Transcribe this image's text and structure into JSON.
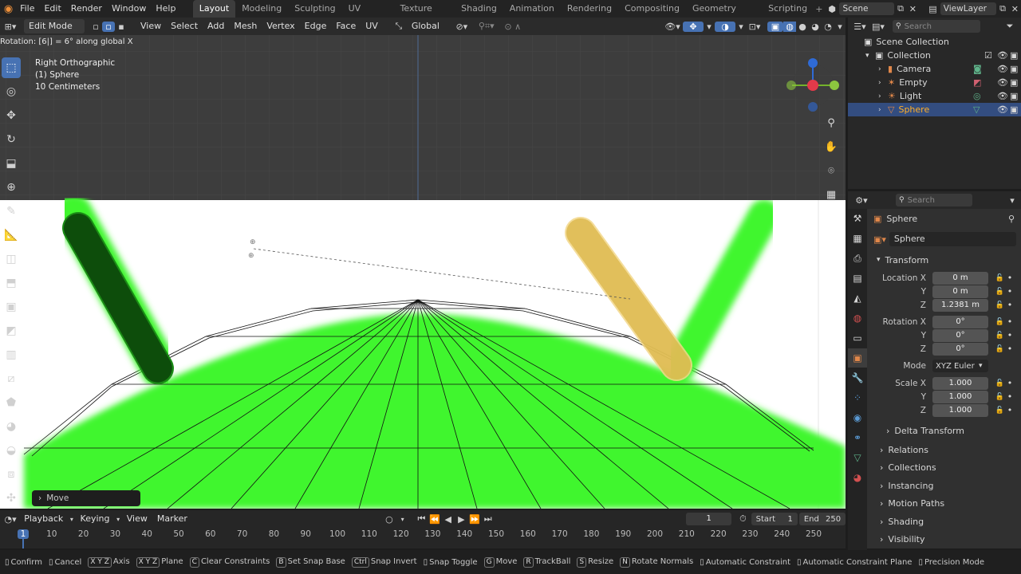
{
  "menu": {
    "items": [
      "File",
      "Edit",
      "Render",
      "Window",
      "Help"
    ]
  },
  "workspaces": {
    "tabs": [
      "Layout",
      "Modeling",
      "Sculpting",
      "UV Editing",
      "Texture Paint",
      "Shading",
      "Animation",
      "Rendering",
      "Compositing",
      "Geometry Nodes",
      "Scripting"
    ],
    "active": "Layout"
  },
  "scene": {
    "name": "Scene",
    "view_layer": "ViewLayer"
  },
  "viewport_header": {
    "mode": "Edit Mode",
    "menus": [
      "View",
      "Select",
      "Add",
      "Mesh",
      "Vertex",
      "Edge",
      "Face",
      "UV"
    ],
    "transform_orientation": "Global"
  },
  "status_text": "Rotation: [6|] = 6°  along global X",
  "overlay": {
    "view": "Right Orthographic",
    "object": "(1) Sphere",
    "scale": "10 Centimeters"
  },
  "operator_panel": {
    "label": "Move"
  },
  "outliner": {
    "search_placeholder": "Search",
    "root": "Scene Collection",
    "collection": "Collection",
    "items": [
      {
        "name": "Camera",
        "icon": "camera-icon",
        "color": "#e0874a"
      },
      {
        "name": "Empty",
        "icon": "empty-icon",
        "color": "#e0874a"
      },
      {
        "name": "Light",
        "icon": "light-icon",
        "color": "#e0874a"
      },
      {
        "name": "Sphere",
        "icon": "mesh-icon",
        "color": "#e0874a",
        "selected": true
      }
    ]
  },
  "properties": {
    "search_placeholder": "Search",
    "object_name": "Sphere",
    "data_name": "Sphere",
    "transform": {
      "title": "Transform",
      "location_label": "Location X",
      "location": [
        "0 m",
        "0 m",
        "1.2381 m"
      ],
      "rotation_label": "Rotation X",
      "rotation": [
        "0°",
        "0°",
        "0°"
      ],
      "mode_label": "Mode",
      "mode": "XYZ Euler",
      "scale_label": "Scale X",
      "scale": [
        "1.000",
        "1.000",
        "1.000"
      ],
      "y_label": "Y",
      "z_label": "Z"
    },
    "delta": "Delta Transform",
    "panels": [
      "Relations",
      "Collections",
      "Instancing",
      "Motion Paths",
      "Shading",
      "Visibility"
    ]
  },
  "timeline": {
    "menus": [
      "Playback",
      "Keying",
      "View",
      "Marker"
    ],
    "current_frame": "1",
    "start_label": "Start",
    "start": "1",
    "end_label": "End",
    "end": "250",
    "ticks": [
      "1",
      "10",
      "20",
      "30",
      "40",
      "50",
      "60",
      "70",
      "80",
      "90",
      "100",
      "110",
      "120",
      "130",
      "140",
      "150",
      "160",
      "170",
      "180",
      "190",
      "200",
      "210",
      "220",
      "230",
      "240",
      "250"
    ]
  },
  "footer": {
    "items": [
      {
        "key": "",
        "label": "Confirm"
      },
      {
        "key": "",
        "label": "Cancel"
      },
      {
        "key": "X Y Z",
        "label": "Axis"
      },
      {
        "key": "X Y Z",
        "label": "Plane"
      },
      {
        "key": "C",
        "label": "Clear Constraints"
      },
      {
        "key": "B",
        "label": "Set Snap Base"
      },
      {
        "key": "Ctrl",
        "label": "Snap Invert"
      },
      {
        "key": "",
        "label": "Snap Toggle"
      },
      {
        "key": "G",
        "label": "Move"
      },
      {
        "key": "R",
        "label": "TrackBall"
      },
      {
        "key": "S",
        "label": "Resize"
      },
      {
        "key": "N",
        "label": "Rotate Normals"
      },
      {
        "key": "",
        "label": "Automatic Constraint"
      },
      {
        "key": "",
        "label": "Automatic Constraint Plane"
      },
      {
        "key": "",
        "label": "Precision Mode"
      }
    ]
  },
  "colors": {
    "accent": "#4772b3",
    "green_screen": "#3ff62f",
    "selection": "#334d80"
  }
}
